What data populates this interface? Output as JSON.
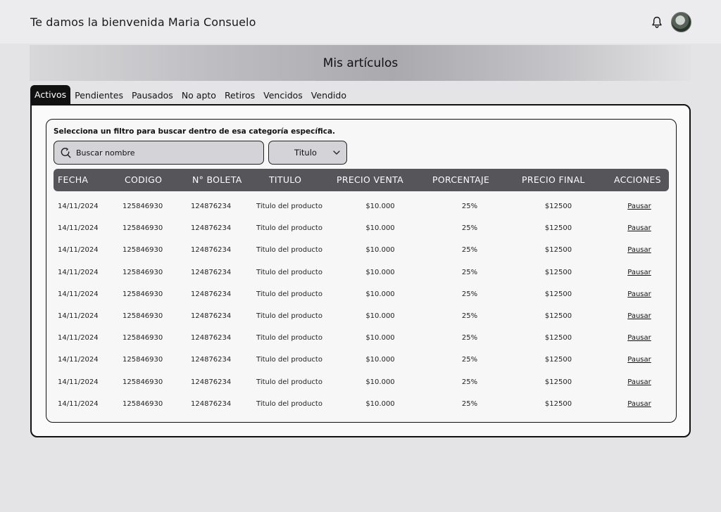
{
  "header": {
    "welcome": "Te damos la bienvenida Maria Consuelo"
  },
  "banner": {
    "title": "Mis artículos"
  },
  "tabs": [
    {
      "label": "Activos",
      "active": true
    },
    {
      "label": "Pendientes"
    },
    {
      "label": "Pausados"
    },
    {
      "label": "No apto"
    },
    {
      "label": "Retiros"
    },
    {
      "label": "Vencidos"
    },
    {
      "label": "Vendido"
    }
  ],
  "filter": {
    "hint": "Selecciona un filtro para buscar dentro de esa categoría específica.",
    "search_placeholder": "Buscar nombre",
    "select_value": "Titulo"
  },
  "table": {
    "columns": [
      "FECHA",
      "CODIGO",
      "N° BOLETA",
      "TITULO",
      "PRECIO VENTA",
      "PORCENTAJE",
      "PRECIO FINAL",
      "ACCIONES"
    ],
    "rows": [
      {
        "fecha": "14/11/2024",
        "codigo": "125846930",
        "boleta": "124876234",
        "titulo": "Titulo del producto",
        "precio_venta": "$10.000",
        "porcentaje": "25%",
        "precio_final": "$12500",
        "accion": "Pausar"
      },
      {
        "fecha": "14/11/2024",
        "codigo": "125846930",
        "boleta": "124876234",
        "titulo": "Titulo del producto",
        "precio_venta": "$10.000",
        "porcentaje": "25%",
        "precio_final": "$12500",
        "accion": "Pausar"
      },
      {
        "fecha": "14/11/2024",
        "codigo": "125846930",
        "boleta": "124876234",
        "titulo": "Titulo del producto",
        "precio_venta": "$10.000",
        "porcentaje": "25%",
        "precio_final": "$12500",
        "accion": "Pausar"
      },
      {
        "fecha": "14/11/2024",
        "codigo": "125846930",
        "boleta": "124876234",
        "titulo": "Titulo del producto",
        "precio_venta": "$10.000",
        "porcentaje": "25%",
        "precio_final": "$12500",
        "accion": "Pausar"
      },
      {
        "fecha": "14/11/2024",
        "codigo": "125846930",
        "boleta": "124876234",
        "titulo": "Titulo del producto",
        "precio_venta": "$10.000",
        "porcentaje": "25%",
        "precio_final": "$12500",
        "accion": "Pausar"
      },
      {
        "fecha": "14/11/2024",
        "codigo": "125846930",
        "boleta": "124876234",
        "titulo": "Titulo del producto",
        "precio_venta": "$10.000",
        "porcentaje": "25%",
        "precio_final": "$12500",
        "accion": "Pausar"
      },
      {
        "fecha": "14/11/2024",
        "codigo": "125846930",
        "boleta": "124876234",
        "titulo": "Titulo del producto",
        "precio_venta": "$10.000",
        "porcentaje": "25%",
        "precio_final": "$12500",
        "accion": "Pausar"
      },
      {
        "fecha": "14/11/2024",
        "codigo": "125846930",
        "boleta": "124876234",
        "titulo": "Titulo del producto",
        "precio_venta": "$10.000",
        "porcentaje": "25%",
        "precio_final": "$12500",
        "accion": "Pausar"
      },
      {
        "fecha": "14/11/2024",
        "codigo": "125846930",
        "boleta": "124876234",
        "titulo": "Titulo del producto",
        "precio_venta": "$10.000",
        "porcentaje": "25%",
        "precio_final": "$12500",
        "accion": "Pausar"
      },
      {
        "fecha": "14/11/2024",
        "codigo": "125846930",
        "boleta": "124876234",
        "titulo": "Titulo del producto",
        "precio_venta": "$10.000",
        "porcentaje": "25%",
        "precio_final": "$12500",
        "accion": "Pausar"
      }
    ]
  },
  "icons": {
    "notifications": "bell-icon",
    "avatar": "user-avatar",
    "search": "search-icon",
    "select": "chevron-down-icon"
  },
  "colors": {
    "table_header_bg": "#55555a",
    "active_tab_bg": "#111111",
    "input_bg": "#d4d4d8"
  }
}
